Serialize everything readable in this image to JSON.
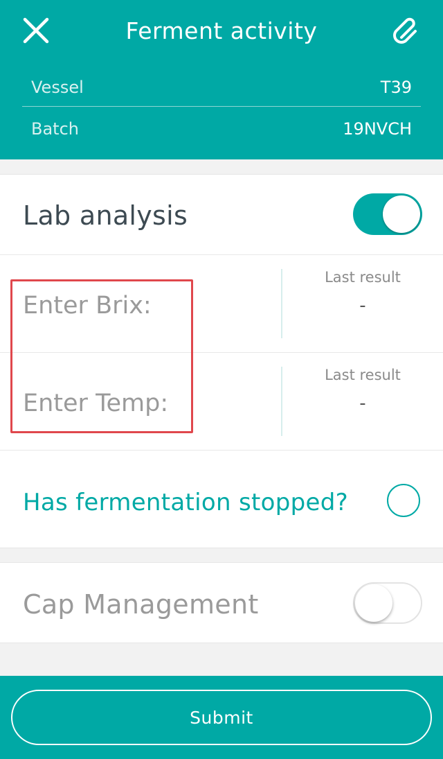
{
  "header": {
    "title": "Ferment activity",
    "close_icon": "close-icon",
    "attach_icon": "paperclip-icon",
    "vessel_label": "Vessel",
    "vessel_value": "T39",
    "batch_label": "Batch",
    "batch_value": "19NVCH"
  },
  "lab": {
    "title": "Lab analysis",
    "toggle_on": true,
    "brix_placeholder": "Enter Brix:",
    "brix_value": "",
    "brix_last_label": "Last result",
    "brix_last_value": "-",
    "temp_placeholder": "Enter Temp:",
    "temp_value": "",
    "temp_last_label": "Last result",
    "temp_last_value": "-",
    "question": "Has fermentation stopped?",
    "question_checked": false
  },
  "cap": {
    "title": "Cap Management",
    "toggle_on": false
  },
  "footer": {
    "submit_label": "Submit"
  },
  "colors": {
    "accent": "#00a9a5",
    "highlight": "#e0474c",
    "text_dark": "#3d4a52",
    "text_muted": "#9a9a9a"
  }
}
